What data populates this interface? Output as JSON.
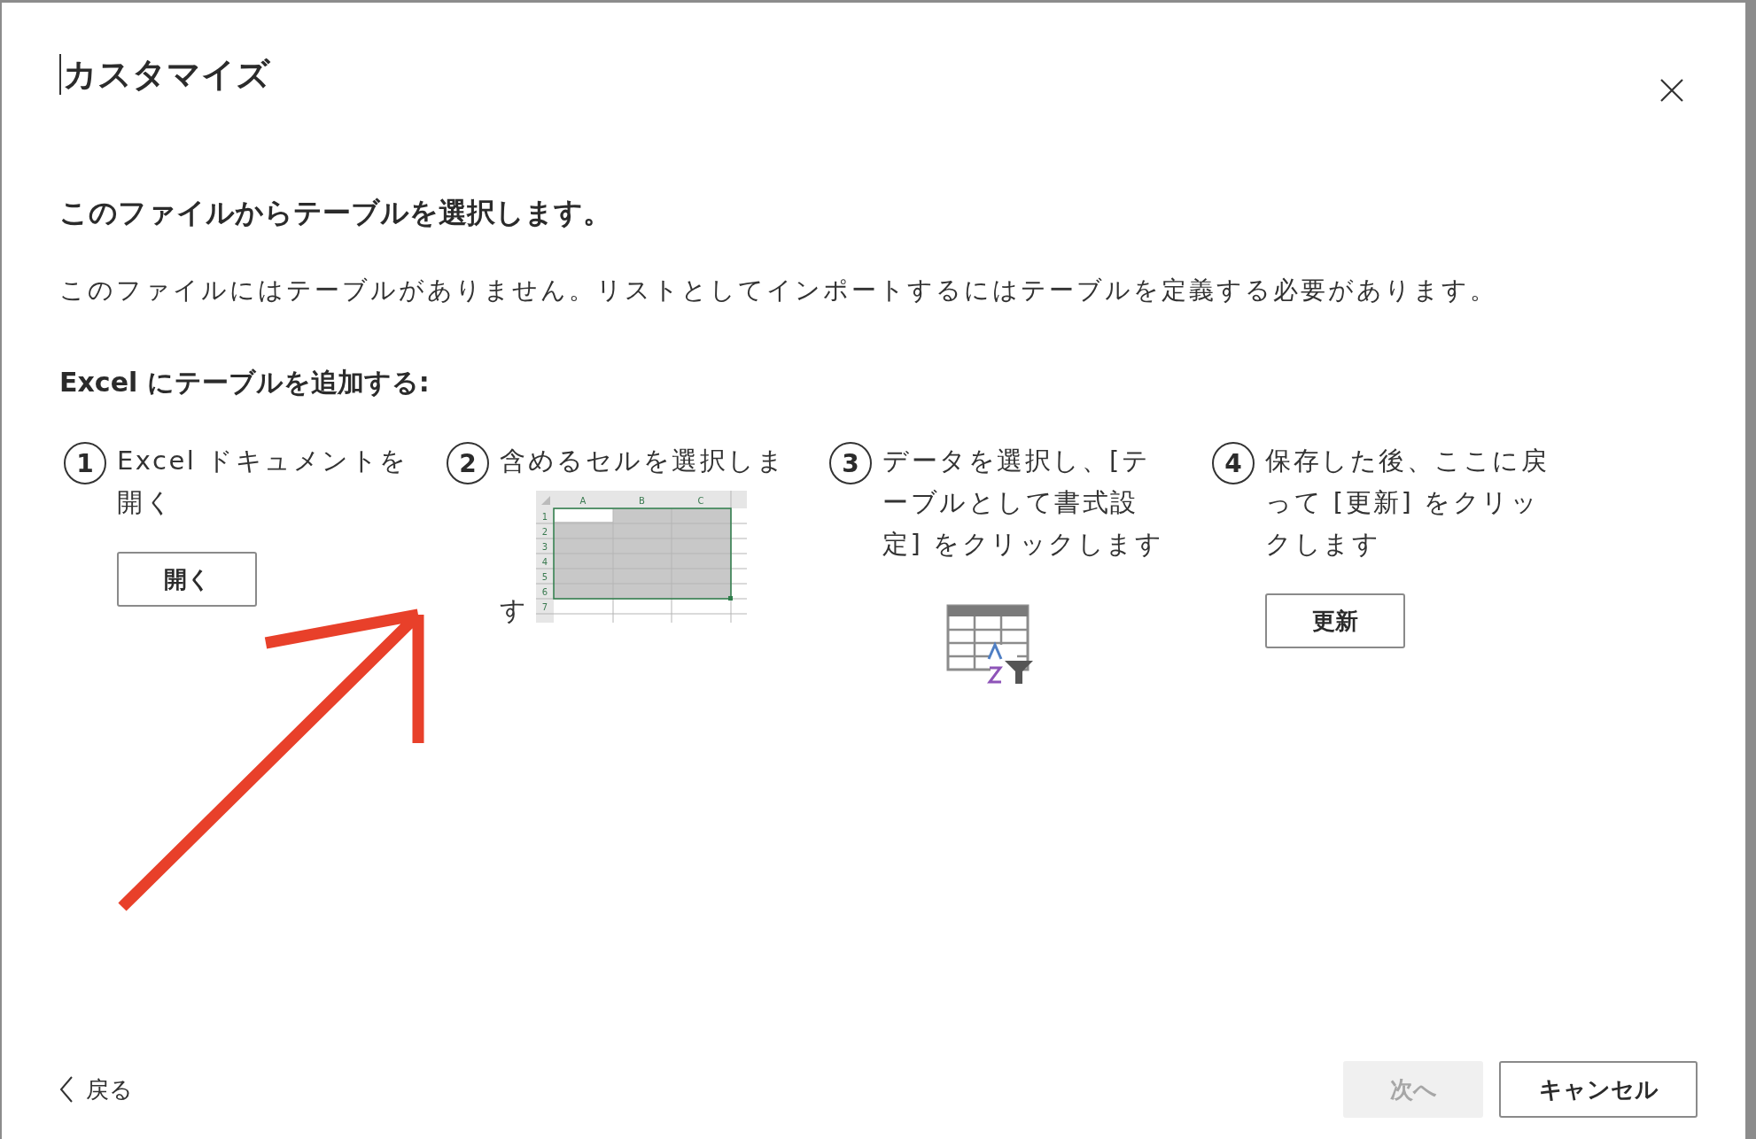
{
  "dialog": {
    "title": "カスタマイズ",
    "heading": "このファイルからテーブルを選択します。",
    "message": "このファイルにはテーブルがありません。リストとしてインポートするにはテーブルを定義する必要があります。",
    "section_label": "Excel にテーブルを追加する:"
  },
  "steps": [
    {
      "number": "1",
      "text": "Excel ドキュメントを開く",
      "kind": "button",
      "button_label": "開く"
    },
    {
      "number": "2",
      "text_lines": [
        "含めるセルを選択しま",
        "す"
      ],
      "kind": "spreadsheet",
      "columns": [
        "A",
        "B",
        "C"
      ],
      "rows": [
        "1",
        "2",
        "3",
        "4",
        "5",
        "6",
        "7"
      ]
    },
    {
      "number": "3",
      "text": "データを選択し、[テーブルとして書式設定] をクリックします",
      "kind": "sort_icon"
    },
    {
      "number": "4",
      "text": "保存した後、ここに戻って [更新] をクリックします",
      "kind": "button",
      "button_label": "更新"
    }
  ],
  "footer": {
    "back": "戻る",
    "next": {
      "label": "次へ",
      "disabled": true
    },
    "cancel": "キャンセル"
  }
}
